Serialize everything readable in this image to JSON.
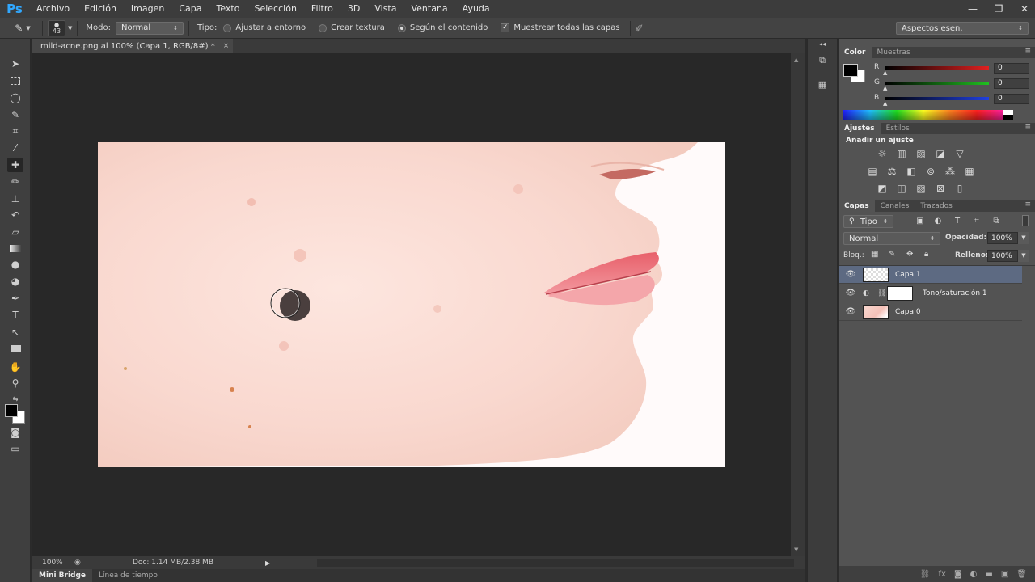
{
  "app": {
    "logo": "Ps"
  },
  "menu": [
    "Archivo",
    "Edición",
    "Imagen",
    "Capa",
    "Texto",
    "Selección",
    "Filtro",
    "3D",
    "Vista",
    "Ventana",
    "Ayuda"
  ],
  "window_controls": {
    "minimize": "—",
    "restore": "❐",
    "close": "✕"
  },
  "options": {
    "brush_size": "43",
    "mode_label": "Modo:",
    "mode_value": "Normal",
    "type_label": "Tipo:",
    "type_options": [
      {
        "label": "Ajustar a entorno",
        "selected": false
      },
      {
        "label": "Crear textura",
        "selected": false
      },
      {
        "label": "Según el contenido",
        "selected": true
      }
    ],
    "sample_all_layers": "Muestrear todas las capas",
    "sample_all_checked": true,
    "workspace": "Aspectos esen."
  },
  "document": {
    "tab_title": "mild-acne.png al 100% (Capa 1, RGB/8#) *",
    "tab_close": "×"
  },
  "status": {
    "zoom": "100%",
    "doc_info": "Doc: 1.14 MB/2.38 MB"
  },
  "bottom_tabs": [
    "Mini Bridge",
    "Línea de tiempo"
  ],
  "color_panel": {
    "tabs": [
      "Color",
      "Muestras"
    ],
    "channels": [
      {
        "label": "R",
        "value": "0",
        "color": "#e02020"
      },
      {
        "label": "G",
        "value": "0",
        "color": "#20c020"
      },
      {
        "label": "B",
        "value": "0",
        "color": "#2040e0"
      }
    ],
    "foreground": "#000000",
    "background": "#ffffff"
  },
  "adjust_panel": {
    "tabs": [
      "Ajustes",
      "Estilos"
    ],
    "title": "Añadir un ajuste"
  },
  "layers_panel": {
    "tabs": [
      "Capas",
      "Canales",
      "Trazados"
    ],
    "filter_kind": "Tipo",
    "blend_mode": "Normal",
    "opacity_label": "Opacidad:",
    "opacity_value": "100%",
    "lock_label": "Bloq.:",
    "fill_label": "Relleno:",
    "fill_value": "100%",
    "layers": [
      {
        "name": "Capa 1",
        "selected": true
      },
      {
        "name": "Tono/saturación 1",
        "selected": false
      },
      {
        "name": "Capa 0",
        "selected": false
      }
    ]
  }
}
